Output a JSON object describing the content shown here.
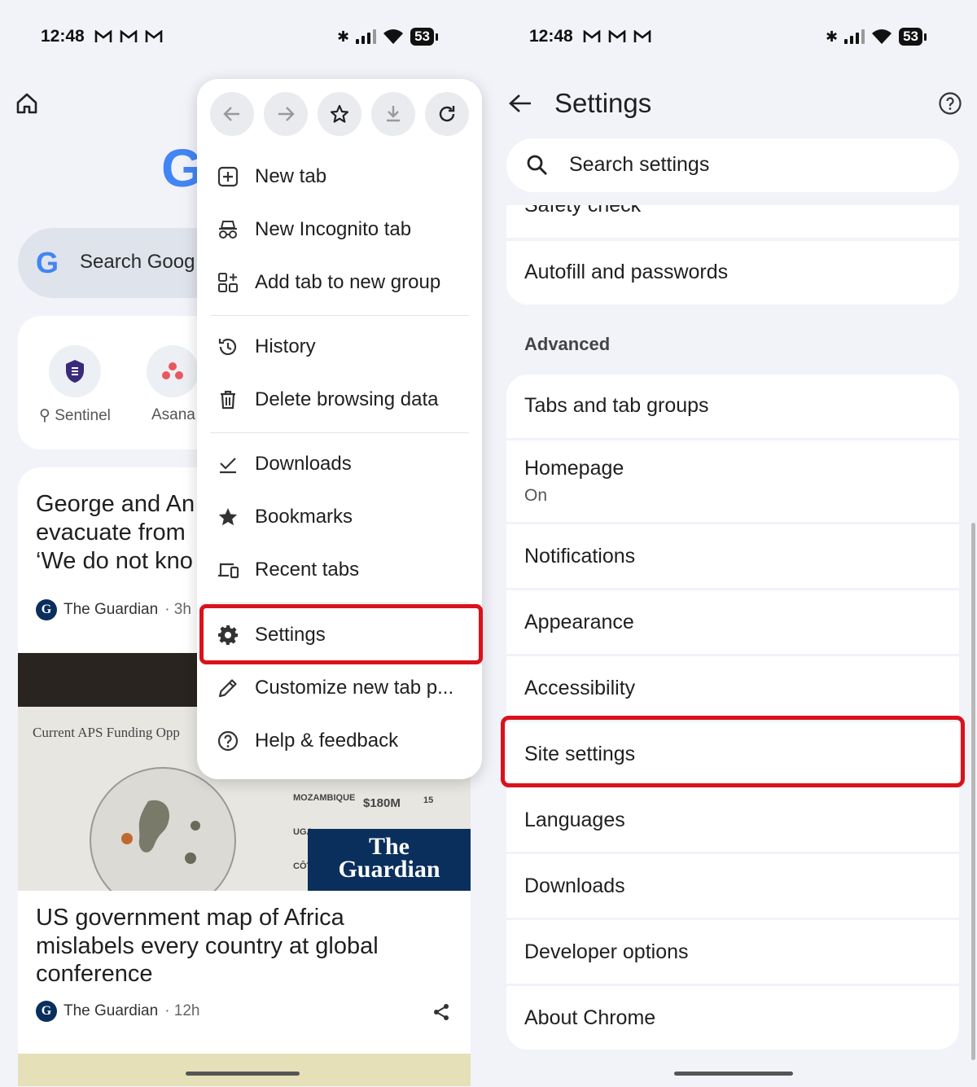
{
  "status_left": {
    "time": "12:48",
    "battery": "53"
  },
  "status_right": {
    "time": "12:48",
    "battery": "53"
  },
  "background": {
    "search_placeholder": "Search Goog",
    "shortcuts": [
      {
        "label": "Sentinel",
        "pin": "⚲"
      },
      {
        "label": "Asana"
      }
    ],
    "article1": {
      "title_lines": [
        "George and An",
        "evacuate from",
        "‘We do not kno"
      ],
      "source": "The Guardian",
      "age": "· 3h"
    },
    "image": {
      "caption": "Current APS Funding Opp",
      "stat1": "MOZAMBIQUE",
      "stat2": "$180M",
      "stat3": "15",
      "stat4": "UGA",
      "stat5": "CÔT",
      "badge_line1": "The",
      "badge_line2": "Guardian"
    },
    "article2": {
      "title_lines": [
        "US government map of Africa",
        "mislabels every country at global",
        "conference"
      ],
      "source": "The Guardian",
      "age": "· 12h"
    }
  },
  "menu": {
    "items": [
      {
        "label": "New tab",
        "icon": "plus-box-icon"
      },
      {
        "label": "New Incognito tab",
        "icon": "incognito-icon"
      },
      {
        "label": "Add tab to new group",
        "icon": "tab-group-icon"
      },
      {
        "label": "History",
        "icon": "history-icon"
      },
      {
        "label": "Delete browsing data",
        "icon": "trash-icon"
      },
      {
        "label": "Downloads",
        "icon": "check-download-icon"
      },
      {
        "label": "Bookmarks",
        "icon": "star-filled-icon"
      },
      {
        "label": "Recent tabs",
        "icon": "devices-icon"
      },
      {
        "label": "Settings",
        "icon": "gear-icon"
      },
      {
        "label": "Customize new tab p...",
        "icon": "pencil-icon"
      },
      {
        "label": "Help & feedback",
        "icon": "help-icon"
      }
    ]
  },
  "settings": {
    "title": "Settings",
    "search_placeholder": "Search settings",
    "partial_row": "Safety check",
    "rows_top": [
      {
        "label": "Autofill and passwords"
      }
    ],
    "section": "Advanced",
    "rows": [
      {
        "label": "Tabs and tab groups"
      },
      {
        "label": "Homepage",
        "sub": "On"
      },
      {
        "label": "Notifications"
      },
      {
        "label": "Appearance"
      },
      {
        "label": "Accessibility"
      },
      {
        "label": "Site settings"
      },
      {
        "label": "Languages"
      },
      {
        "label": "Downloads"
      },
      {
        "label": "Developer options"
      },
      {
        "label": "About Chrome"
      }
    ]
  },
  "colors": {
    "highlight": "#d9121b",
    "accent": "#4285f4",
    "background": "#f1f3f9"
  }
}
